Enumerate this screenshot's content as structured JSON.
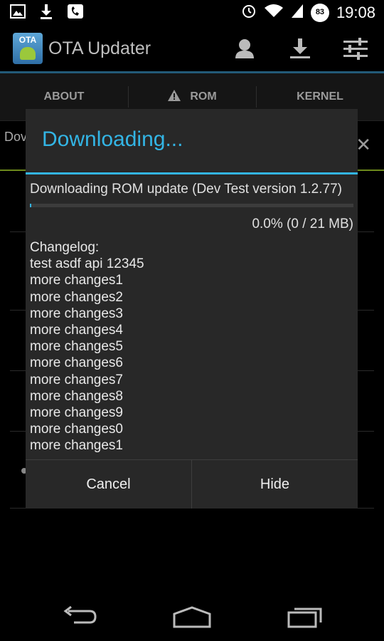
{
  "status_bar": {
    "time": "19:08",
    "battery_level": "83",
    "left_icons": [
      "image-icon",
      "download-icon",
      "missed-call-icon"
    ],
    "right_icons": [
      "alarm-icon",
      "wifi-icon",
      "signal-icon",
      "battery-icon"
    ]
  },
  "action_bar": {
    "app_icon_text": "OTA",
    "title": "OTA Updater",
    "actions": [
      "account-icon",
      "download-icon",
      "settings-sliders-icon"
    ]
  },
  "tabs": [
    {
      "label": "ABOUT",
      "icon": null
    },
    {
      "label": "ROM",
      "icon": "warning-icon"
    },
    {
      "label": "KERNEL",
      "icon": null
    }
  ],
  "background": {
    "peek_text": "Dov",
    "close_icon": "close-icon"
  },
  "dialog": {
    "title": "Downloading...",
    "message": "Downloading ROM update (Dev Test version 1.2.77)",
    "progress_fraction": 0.0,
    "progress_text": "0.0% (0 / 21 MB)",
    "changelog": [
      "Changelog:",
      "test asdf api 12345",
      "more changes1",
      "more changes2",
      "more changes3",
      "more changes4",
      "more changes5",
      "more changes6",
      "more changes7",
      "more changes8",
      "more changes9",
      "more changes0",
      "more changes1"
    ],
    "cancel_label": "Cancel",
    "hide_label": "Hide"
  },
  "colors": {
    "accent": "#33b5e5",
    "dialog_bg": "#282828",
    "background": "#000000"
  }
}
